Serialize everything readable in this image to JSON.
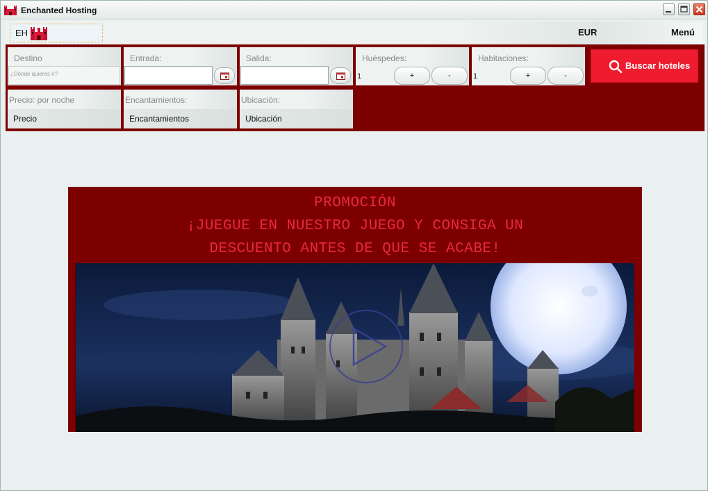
{
  "window": {
    "title": "Enchanted Hosting",
    "controls": [
      "minimize-icon",
      "maximize-icon",
      "close-icon"
    ]
  },
  "topbar": {
    "logo_text": "EH",
    "currency": "EUR",
    "menu": "Menú"
  },
  "search": {
    "destino": {
      "label": "Destino",
      "placeholder": "¿Dónde quieres ir?"
    },
    "entrada": {
      "label": "Entrada:",
      "value": ""
    },
    "salida": {
      "label": "Salida:",
      "value": ""
    },
    "huespedes": {
      "label": "Huéspedes:",
      "count": "1",
      "plus": "+",
      "minus": "-"
    },
    "habitaciones": {
      "label": "Habitaciones:",
      "count": "1",
      "plus": "+",
      "minus": "-"
    },
    "button": "Buscar hoteles",
    "precio": {
      "label": "Precio: por noche",
      "value": "Precio"
    },
    "encantamientos": {
      "label": "Encantamientos:",
      "value": "Encantamientos"
    },
    "ubicacion": {
      "label": "Ubicación:",
      "value": "Ubicación"
    }
  },
  "promo": {
    "line1": "PROMOCIÓN",
    "line2": "¡JUEGUE EN NUESTRO JUEGO Y CONSIGA UN",
    "line3": "DESCUENTO ANTES DE QUE SE ACABE!",
    "media_icon": "play-icon"
  },
  "colors": {
    "panel": "#7d0000",
    "button": "#ee1c2e",
    "promo_text": "#e8283f",
    "window_bg": "#eaf0ef"
  }
}
